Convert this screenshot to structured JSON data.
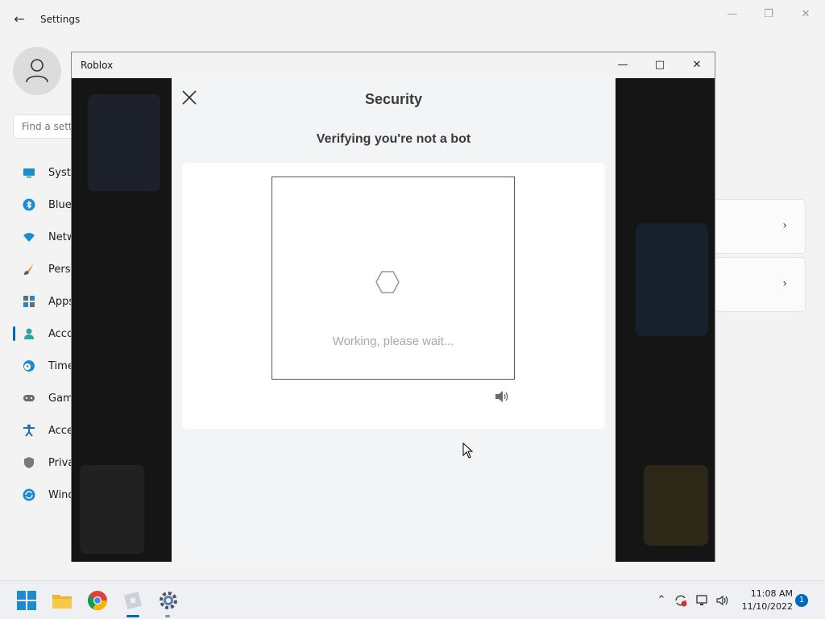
{
  "settings": {
    "title": "Settings",
    "search_placeholder": "Find a setting",
    "nav": [
      {
        "label": "System",
        "icon": "monitor-icon"
      },
      {
        "label": "Bluetooth & devices",
        "icon": "bluetooth-icon"
      },
      {
        "label": "Network & internet",
        "icon": "wifi-icon"
      },
      {
        "label": "Personalization",
        "icon": "brush-icon"
      },
      {
        "label": "Apps",
        "icon": "apps-icon"
      },
      {
        "label": "Accounts",
        "icon": "person-icon"
      },
      {
        "label": "Time & language",
        "icon": "clock-globe-icon"
      },
      {
        "label": "Gaming",
        "icon": "gamepad-icon"
      },
      {
        "label": "Accessibility",
        "icon": "accessibility-icon"
      },
      {
        "label": "Privacy & security",
        "icon": "shield-icon"
      },
      {
        "label": "Windows Update",
        "icon": "update-icon"
      }
    ]
  },
  "roblox": {
    "window_title": "Roblox",
    "modal": {
      "title": "Security",
      "subtitle": "Verifying you're not a bot",
      "status": "Working, please wait..."
    }
  },
  "taskbar": {
    "time": "11:08 AM",
    "date": "11/10/2022",
    "notification_count": "1",
    "apps": [
      "start-icon",
      "file-explorer-icon",
      "chrome-icon",
      "roblox-icon",
      "settings-gear-icon"
    ]
  },
  "colors": {
    "accent": "#0067c0",
    "modal_bg": "#f2f4f5",
    "title_text": "#393b3d"
  }
}
